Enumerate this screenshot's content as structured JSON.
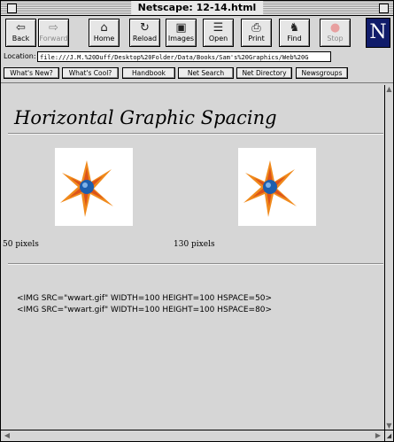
{
  "window": {
    "title": "Netscape: 12-14.html"
  },
  "toolbar": {
    "buttons": [
      {
        "label": "Back",
        "icon": "back-arrow-icon",
        "glyph": "⇦",
        "enabled": true
      },
      {
        "label": "Forward",
        "icon": "forward-arrow-icon",
        "glyph": "⇨",
        "enabled": false
      },
      {
        "label": "Home",
        "icon": "home-icon",
        "glyph": "⌂",
        "enabled": true
      },
      {
        "label": "Reload",
        "icon": "reload-icon",
        "glyph": "↻",
        "enabled": true
      },
      {
        "label": "Images",
        "icon": "images-icon",
        "glyph": "▣",
        "enabled": true
      },
      {
        "label": "Open",
        "icon": "open-icon",
        "glyph": "☰",
        "enabled": true
      },
      {
        "label": "Print",
        "icon": "print-icon",
        "glyph": "⎙",
        "enabled": true
      },
      {
        "label": "Find",
        "icon": "find-icon",
        "glyph": "♞",
        "enabled": true
      },
      {
        "label": "Stop",
        "icon": "stop-icon",
        "glyph": "●",
        "enabled": false
      }
    ],
    "logo": "N"
  },
  "location": {
    "label": "Location:",
    "value": "file:///J.M.%20Duff/Desktop%20Folder/Data/Books/Sam's%20Graphics/Web%20G"
  },
  "directory": {
    "buttons": [
      "What's New?",
      "What's Cool?",
      "Handbook",
      "Net Search",
      "Net Directory",
      "Newsgroups"
    ]
  },
  "page": {
    "heading": "Horizontal Graphic Spacing",
    "caption_left": "50 pixels",
    "caption_right": "130 pixels",
    "code_line_1": "<IMG SRC=\"wwart.gif\" WIDTH=100 HEIGHT=100 HSPACE=50>",
    "code_line_2": "<IMG SRC=\"wwart.gif\" WIDTH=100 HEIGHT=100 HSPACE=80>"
  },
  "colors": {
    "window_bg": "#d6d6d6",
    "logo_bg": "#101c6a",
    "star_orange": "#f08a1c",
    "star_red": "#d8481a",
    "sphere_blue": "#1d5fae"
  }
}
